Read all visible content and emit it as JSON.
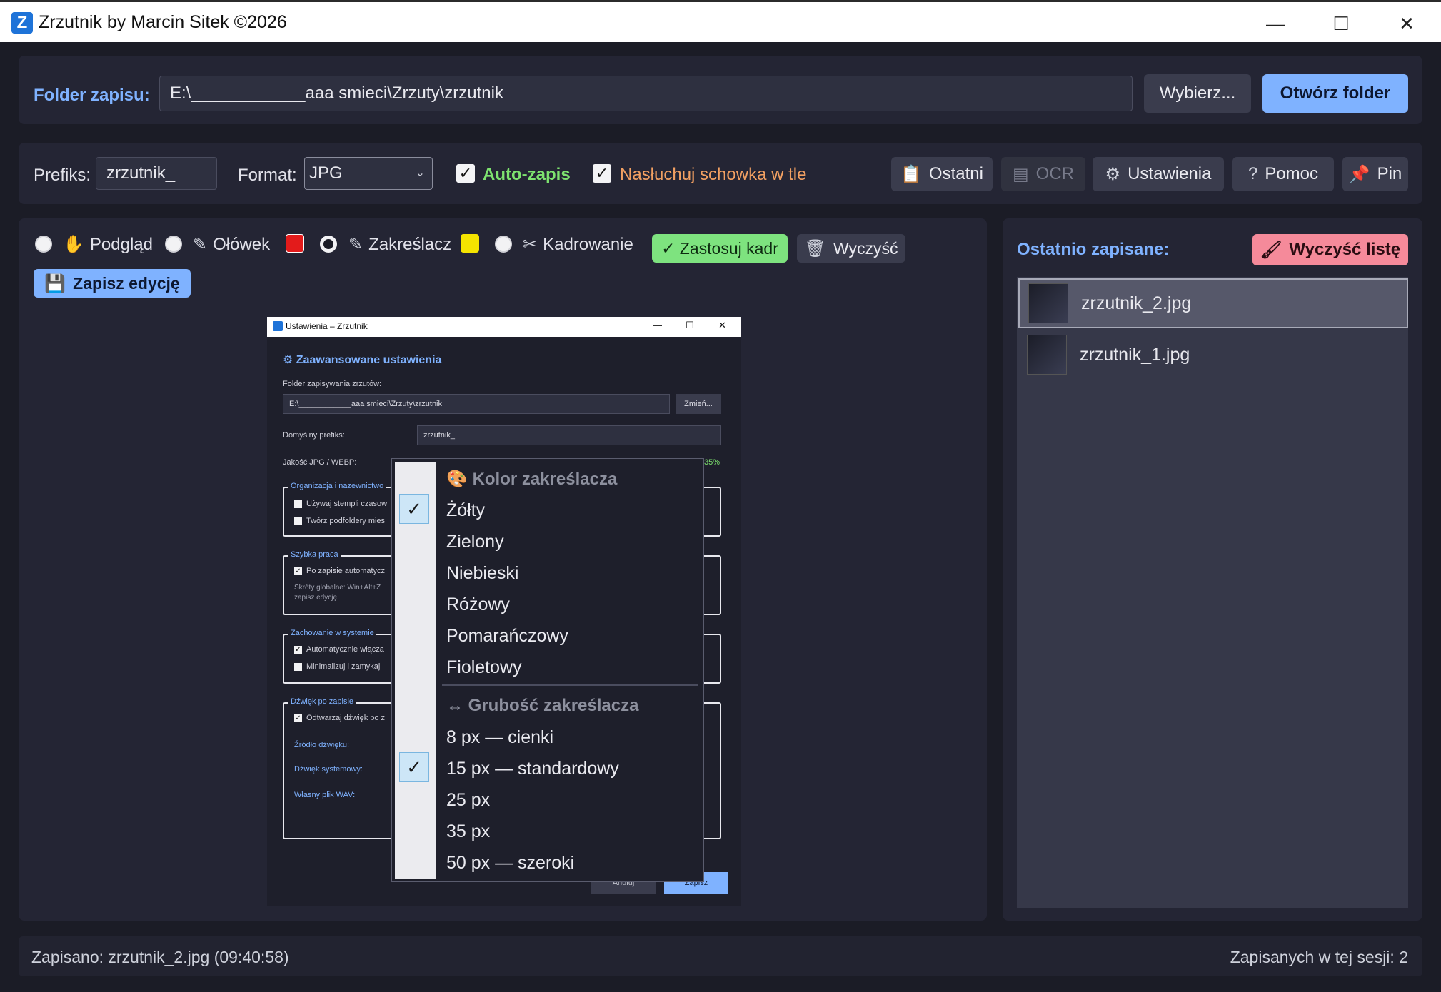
{
  "window": {
    "title": "Zrzutnik by Marcin Sitek ©2026",
    "app_icon_letter": "Z"
  },
  "folder_bar": {
    "label": "Folder zapisu:",
    "path": "E:\\____________aaa smieci\\Zrzuty\\zrzutnik",
    "choose_label": "Wybierz...",
    "open_label": "Otwórz folder"
  },
  "options_bar": {
    "prefix_label": "Prefiks:",
    "prefix_value": "zrzutnik_",
    "format_label": "Format:",
    "format_value": "JPG",
    "autosave_label": "Auto-zapis",
    "autosave_checked": true,
    "clipboard_label": "Nasłuchuj schowka w tle",
    "clipboard_checked": true,
    "buttons": {
      "recent": "Ostatni",
      "ocr": "OCR",
      "settings": "Ustawienia",
      "help": "Pomoc",
      "pin": "Pin"
    }
  },
  "tools": {
    "preview": "Podgląd",
    "pencil": "Ołówek",
    "highlighter": "Zakreślacz",
    "crop": "Kadrowanie",
    "apply_crop": "✓ Zastosuj kadr",
    "clear": "Wyczyść",
    "save_edit": "Zapisz edycję",
    "selected": "highlighter",
    "pencil_color": "#e31b1b",
    "highlighter_color": "#f5e400"
  },
  "recent": {
    "title": "Ostatnio zapisane:",
    "clear_label": "Wyczyść listę",
    "items": [
      {
        "name": "zrzutnik_2.jpg",
        "selected": true
      },
      {
        "name": "zrzutnik_1.jpg",
        "selected": false
      }
    ]
  },
  "inner_settings": {
    "window_title": "Ustawienia – Zrzutnik",
    "heading": "Zaawansowane ustawienia",
    "folder_label": "Folder zapisywania zrzutów:",
    "folder_value": "E:\\____________aaa smieci\\Zrzuty\\zrzutnik",
    "change_label": "Zmień...",
    "prefix_label": "Domyślny prefiks:",
    "prefix_value": "zrzutnik_",
    "quality_label": "Jakość JPG / WEBP:",
    "quality_value": "35%",
    "group_org": "Organizacja i nazewnictwo",
    "org_1": "Używaj stempli czasow",
    "org_2": "Twórz podfoldery mies",
    "group_fast": "Szybka praca",
    "fast_1": "Po zapisie automatycz",
    "fast_note": "Skróty globalne: Win+Alt+Z",
    "fast_note2": "zapisz edycję.",
    "group_sys": "Zachowanie w systemie",
    "sys_1": "Automatycznie włącza",
    "sys_2": "Minimalizuj i zamykaj",
    "group_sound": "Dźwięk po zapisie",
    "sound_1": "Odtwarzaj dźwięk po z",
    "sound_src": "Źródło dźwięku:",
    "sound_sys": "Dźwięk systemowy:",
    "sound_wav": "Własny plik WAV:",
    "cancel": "Anuluj",
    "save": "Zapisz"
  },
  "context_menu": {
    "color_header": "Kolor zakreślacza",
    "colors": [
      "Żółty",
      "Zielony",
      "Niebieski",
      "Różowy",
      "Pomarańczowy",
      "Fioletowy"
    ],
    "selected_color": "Żółty",
    "width_header": "↔ Grubość zakreślacza",
    "widths": [
      "8 px — cienki",
      "15 px — standardowy",
      "25 px",
      "35 px",
      "50 px — szeroki"
    ],
    "selected_width": "15 px — standardowy"
  },
  "status": {
    "left": "Zapisano: zrzutnik_2.jpg (09:40:58)",
    "right": "Zapisanych w tej sesji: 2"
  }
}
